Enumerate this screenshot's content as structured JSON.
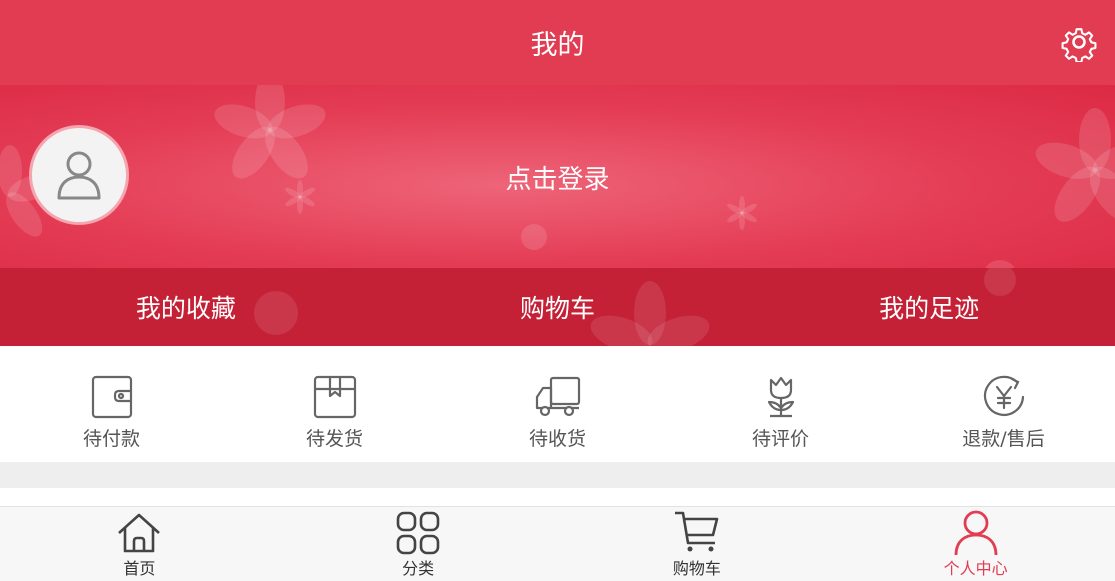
{
  "header": {
    "title": "我的",
    "settings_icon": "gear-icon"
  },
  "profile": {
    "avatar_icon": "user-icon",
    "login_text": "点击登录"
  },
  "quick_links": [
    {
      "label": "我的收藏"
    },
    {
      "label": "购物车"
    },
    {
      "label": "我的足迹"
    }
  ],
  "order_status": [
    {
      "label": "待付款",
      "icon": "wallet-icon"
    },
    {
      "label": "待发货",
      "icon": "package-icon"
    },
    {
      "label": "待收货",
      "icon": "truck-icon"
    },
    {
      "label": "待评价",
      "icon": "flower-icon"
    },
    {
      "label": "退款/售后",
      "icon": "yen-refund-icon"
    }
  ],
  "tabbar": [
    {
      "label": "首页",
      "icon": "home-icon",
      "active": false
    },
    {
      "label": "分类",
      "icon": "grid-icon",
      "active": false
    },
    {
      "label": "购物车",
      "icon": "cart-icon",
      "active": false
    },
    {
      "label": "个人中心",
      "icon": "person-icon",
      "active": true
    }
  ],
  "colors": {
    "brand": "#e23c52",
    "quickbar": "#c42036",
    "icon_gray": "#666666",
    "active_tab": "#e23c52"
  }
}
